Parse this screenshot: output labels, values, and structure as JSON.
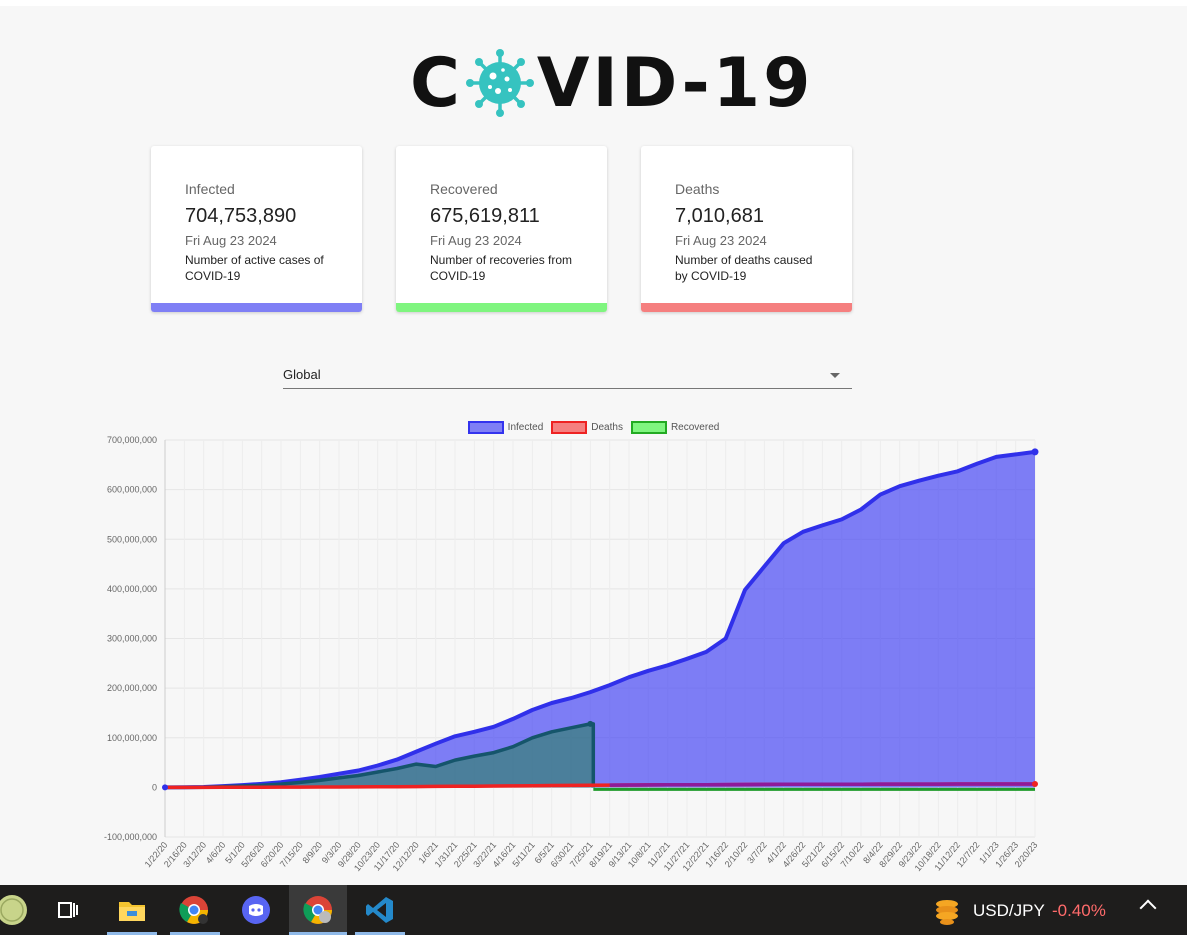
{
  "logo": {
    "left": "C",
    "right": "VID-19"
  },
  "cards": [
    {
      "label": "Infected",
      "count": "704,753,890",
      "date": "Fri Aug 23 2024",
      "desc": "Number of active cases of COVID-19",
      "color": "#7f7ff5"
    },
    {
      "label": "Recovered",
      "count": "675,619,811",
      "date": "Fri Aug 23 2024",
      "desc": "Number of recoveries from COVID-19",
      "color": "#7ff57f"
    },
    {
      "label": "Deaths",
      "count": "7,010,681",
      "date": "Fri Aug 23 2024",
      "desc": "Number of deaths caused by COVID-19",
      "color": "#f57f7f"
    }
  ],
  "country_select": {
    "value": "Global"
  },
  "chart_data": {
    "type": "area",
    "legend": [
      "Infected",
      "Deaths",
      "Recovered"
    ],
    "colors": {
      "Infected": "#3333ee",
      "Deaths": "#ee2222",
      "Recovered": "#22aa22"
    },
    "y_ticks": [
      "700,000,000",
      "600,000,000",
      "500,000,000",
      "400,000,000",
      "300,000,000",
      "200,000,000",
      "100,000,000",
      "0",
      "-100,000,000"
    ],
    "ylim": [
      -100000000,
      700000000
    ],
    "x_ticks": [
      "1/22/20",
      "2/16/20",
      "3/12/20",
      "4/6/20",
      "5/1/20",
      "5/26/20",
      "6/20/20",
      "7/15/20",
      "8/9/20",
      "9/3/20",
      "9/28/20",
      "10/23/20",
      "11/17/20",
      "12/12/20",
      "1/6/21",
      "1/31/21",
      "2/25/21",
      "3/22/21",
      "4/16/21",
      "5/11/21",
      "6/5/21",
      "6/30/21",
      "7/25/21",
      "8/19/21",
      "9/13/21",
      "10/8/21",
      "11/2/21",
      "11/27/21",
      "12/22/21",
      "1/16/22",
      "2/10/22",
      "3/7/22",
      "4/1/22",
      "4/26/22",
      "5/21/22",
      "6/15/22",
      "7/10/22",
      "8/4/22",
      "8/29/22",
      "9/23/22",
      "10/18/22",
      "11/12/22",
      "12/7/22",
      "1/1/23",
      "1/26/23",
      "2/20/23"
    ],
    "series": [
      {
        "name": "Infected",
        "values": [
          0,
          200000,
          800000,
          2500000,
          4500000,
          7000000,
          10500000,
          15500000,
          21000000,
          27500000,
          34000000,
          44000000,
          56000000,
          72000000,
          88000000,
          103000000,
          112000000,
          122000000,
          138000000,
          156000000,
          170000000,
          180000000,
          192000000,
          206000000,
          222000000,
          235000000,
          246000000,
          259000000,
          273000000,
          300000000,
          398000000,
          445000000,
          492000000,
          515000000,
          528000000,
          540000000,
          560000000,
          590000000,
          607000000,
          618000000,
          628000000,
          637000000,
          652000000,
          666000000,
          671000000,
          676000000
        ]
      },
      {
        "name": "Deaths",
        "values": [
          0,
          5000,
          50000,
          200000,
          300000,
          380000,
          460000,
          560000,
          700000,
          850000,
          1000000,
          1150000,
          1350000,
          1600000,
          1900000,
          2200000,
          2450000,
          2700000,
          3000000,
          3300000,
          3700000,
          3950000,
          4200000,
          4500000,
          4700000,
          4900000,
          5100000,
          5250000,
          5450000,
          5650000,
          5850000,
          6050000,
          6200000,
          6300000,
          6350000,
          6420000,
          6480000,
          6550000,
          6600000,
          6650000,
          6690000,
          6720000,
          6750000,
          6800000,
          6840000,
          6870000
        ]
      },
      {
        "name": "Recovered",
        "values": [
          0,
          30000,
          300000,
          1500000,
          2700000,
          4200000,
          6500000,
          10000000,
          14000000,
          19000000,
          24000000,
          31000000,
          38000000,
          47000000,
          42000000,
          55000000,
          63000000,
          70000000,
          82000000,
          100000000,
          112000000,
          120000000,
          128000000,
          0,
          0,
          0,
          0,
          0,
          0,
          0,
          0,
          0,
          0,
          0,
          0,
          0,
          0,
          0,
          0,
          0,
          0,
          0,
          0,
          0,
          0,
          0
        ]
      }
    ]
  },
  "taskbar": {
    "items": [
      "melon-icon",
      "task-view-icon",
      "file-explorer-icon",
      "chrome-icon",
      "discord-icon",
      "chrome-profile-icon",
      "vscode-icon"
    ],
    "ticker": {
      "pair": "USD/JPY",
      "change": "-0.40%"
    }
  }
}
